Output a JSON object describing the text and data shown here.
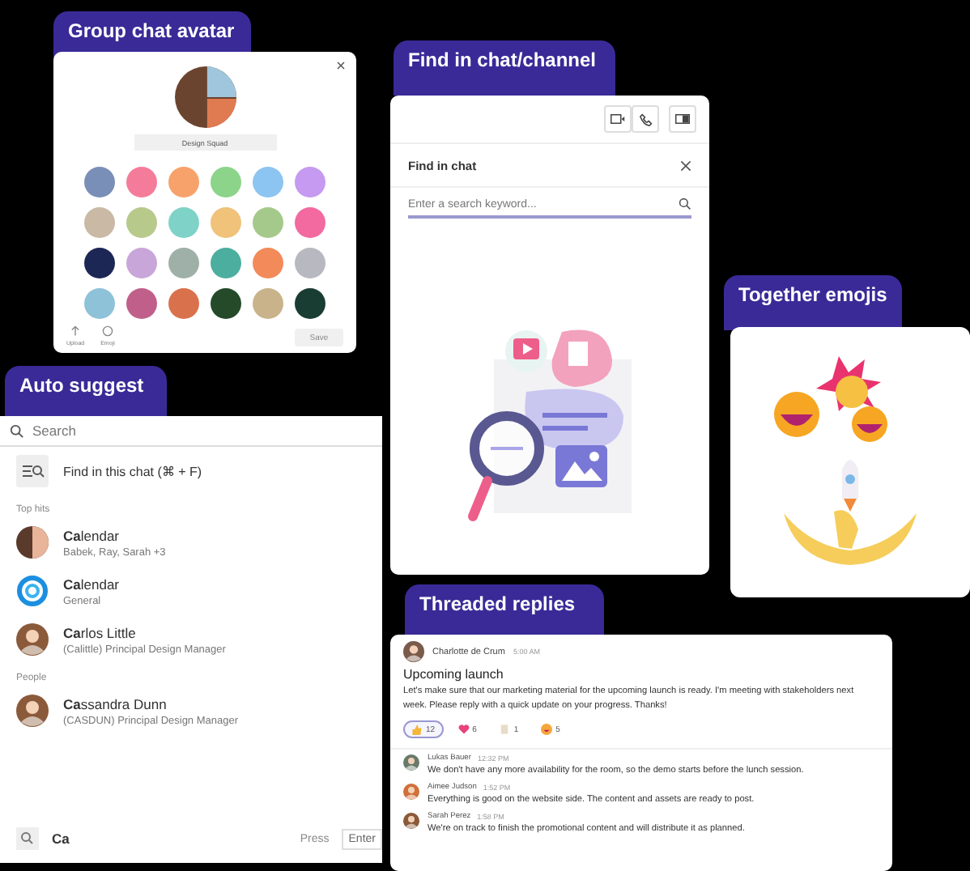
{
  "group_chat_avatar": {
    "label": "Group chat avatar",
    "group_name": "Design Squad",
    "actions": [
      "Upload",
      "Emoji"
    ],
    "save_button": {
      "label": "Save",
      "disabled": true
    }
  },
  "find_in_chat": {
    "label": "Find in chat/channel",
    "panel_title": "Find in chat",
    "search": {
      "placeholder": "Enter a search keyword..."
    }
  },
  "together_emojis": {
    "label": "Together emojis"
  },
  "auto_suggest": {
    "label": "Auto suggest",
    "search": {
      "placeholder": "Search"
    },
    "find_option": "Find in this chat (⌘ + F)",
    "sections": [
      {
        "title": "Top hits",
        "items": [
          {
            "kind": "group",
            "title": "**Ca**lendar",
            "subtitle": "Babek, Ray, Sarah +3"
          },
          {
            "kind": "channel",
            "title": "**Ca**lendar",
            "subtitle": "General"
          },
          {
            "kind": "person",
            "title": "**Ca**rlos Little",
            "subtitle": "(Calittle) Principal Design Manager"
          }
        ]
      },
      {
        "title": "People",
        "items": [
          {
            "kind": "person",
            "title": "**Ca**ssandra Dunn",
            "subtitle": "(CASDUN) Principal Design Manager"
          }
        ]
      }
    ],
    "query": "Ca",
    "hint": "Press",
    "key": "Enter"
  },
  "threaded_replies": {
    "label": "Threaded replies",
    "post": {
      "author": "Charlotte de Crum",
      "time": "5:00 AM",
      "subject": "Upcoming launch",
      "body": "Let's make sure that our marketing material for the upcoming launch is ready. I'm meeting with stakeholders next week. Please reply with a quick update on your progress. Thanks!",
      "reactions": [
        {
          "kind": "like",
          "count": "12",
          "selected": true
        },
        {
          "kind": "heart",
          "count": "6",
          "selected": false
        },
        {
          "kind": "note",
          "count": "1",
          "selected": false
        },
        {
          "kind": "laugh",
          "count": "5",
          "selected": false
        }
      ]
    },
    "replies": [
      {
        "author": "Lukas Bauer",
        "time": "12:32 PM",
        "text": "We don't have any more availability for the room, so the demo starts before the lunch session."
      },
      {
        "author": "Aimee Judson",
        "time": "1:52 PM",
        "text": "Everything is good on the website side. The content and assets are ready to post."
      },
      {
        "author": "Sarah Perez",
        "time": "1:58 PM",
        "text": "We're on track to finish the promotional content and will distribute it as planned."
      }
    ]
  }
}
